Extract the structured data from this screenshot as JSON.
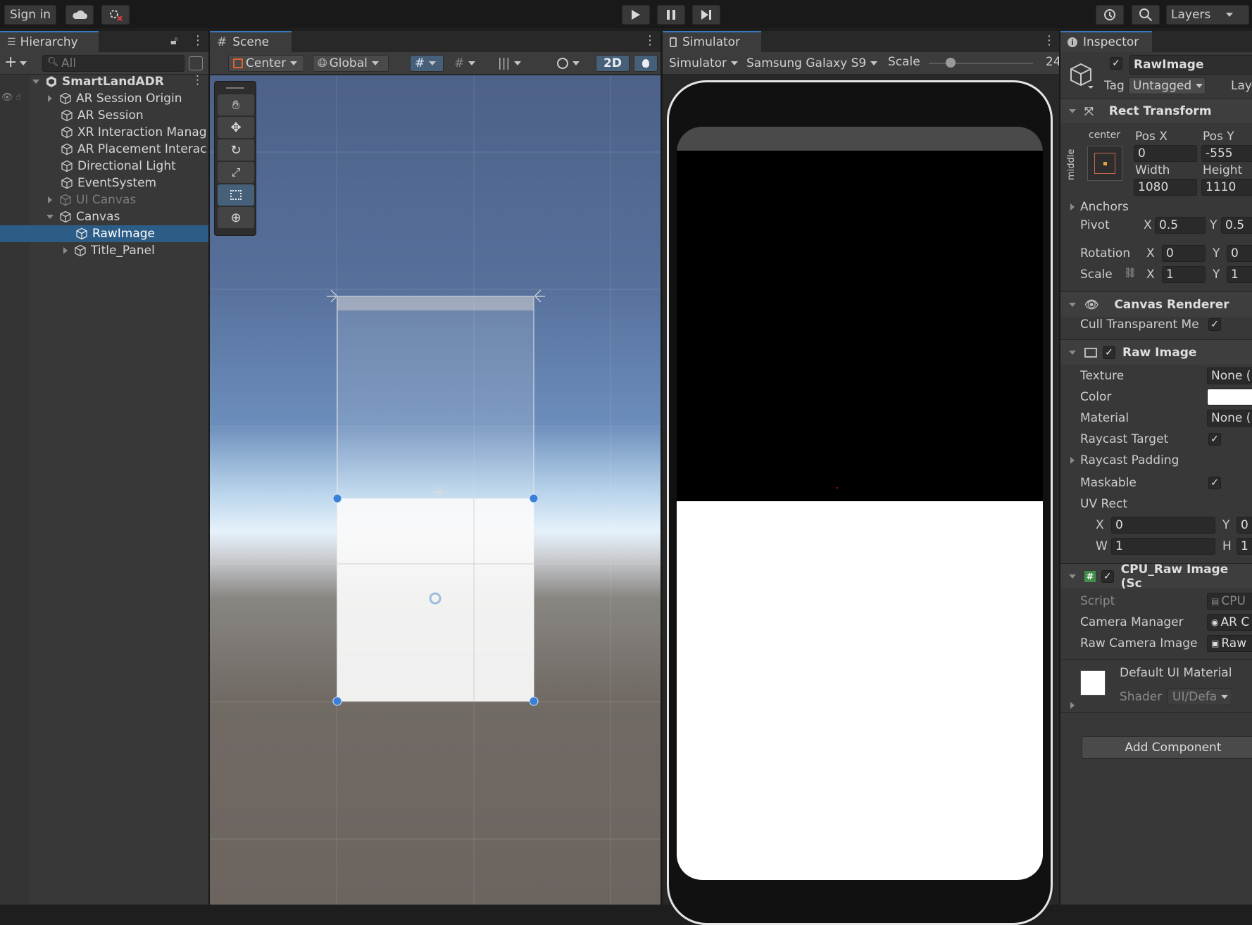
{
  "toolbar": {
    "sign_in": "Sign in",
    "layers": "Layers"
  },
  "hierarchy": {
    "tab": "Hierarchy",
    "search_placeholder": "All",
    "scene_name": "SmartLandADR",
    "items": [
      {
        "label": "AR Session Origin"
      },
      {
        "label": "AR Session"
      },
      {
        "label": "XR Interaction Manag"
      },
      {
        "label": "AR Placement Interac"
      },
      {
        "label": "Directional Light"
      },
      {
        "label": "EventSystem"
      },
      {
        "label": "UI Canvas"
      },
      {
        "label": "Canvas"
      },
      {
        "label": "RawImage"
      },
      {
        "label": "Title_Panel"
      }
    ]
  },
  "scene": {
    "tab": "Scene",
    "pivot_mode": "Center",
    "space_mode": "Global",
    "mode_2d": "2D"
  },
  "simulator": {
    "tab": "Simulator",
    "mode": "Simulator",
    "device": "Samsung Galaxy S9",
    "scale_label": "Scale",
    "scale_value": "24"
  },
  "inspector": {
    "tab": "Inspector",
    "object_name": "RawImage",
    "tag_label": "Tag",
    "tag_value": "Untagged",
    "layer_label": "Lay",
    "rect_transform": {
      "title": "Rect Transform",
      "anchor_h": "center",
      "anchor_v": "middle",
      "pos_x_label": "Pos X",
      "pos_y_label": "Pos Y",
      "pos_x": "0",
      "pos_y": "-555",
      "width_label": "Width",
      "height_label": "Height",
      "width": "1080",
      "height": "1110",
      "anchors": "Anchors",
      "pivot": "Pivot",
      "pivot_x": "0.5",
      "pivot_y": "0.5",
      "rotation": "Rotation",
      "rot_x": "0",
      "rot_y": "0",
      "scale": "Scale",
      "scale_x": "1",
      "scale_y": "1",
      "x": "X",
      "y": "Y"
    },
    "canvas_renderer": {
      "title": "Canvas Renderer",
      "cull": "Cull Transparent Me"
    },
    "raw_image": {
      "title": "Raw Image",
      "texture": "Texture",
      "texture_value": "None (",
      "color": "Color",
      "material": "Material",
      "material_value": "None (",
      "raycast_target": "Raycast Target",
      "raycast_padding": "Raycast Padding",
      "maskable": "Maskable",
      "uv_rect": "UV Rect",
      "uv_x": "0",
      "uv_y": "0",
      "uv_w": "1",
      "uv_h": "1",
      "w": "W",
      "h": "H"
    },
    "cpu_script": {
      "title": "CPU_Raw Image (Sc",
      "script": "Script",
      "script_value": "CPU",
      "camera_manager": "Camera Manager",
      "camera_manager_value": "AR C",
      "raw_camera_image": "Raw Camera Image",
      "raw_camera_image_value": "Raw"
    },
    "material": {
      "name": "Default UI Material",
      "shader_label": "Shader",
      "shader_value": "UI/Defa"
    },
    "add_component": "Add Component"
  },
  "colors": {
    "accent": "#3a79bb",
    "selection": "#2c5d87",
    "panel": "#383838"
  }
}
